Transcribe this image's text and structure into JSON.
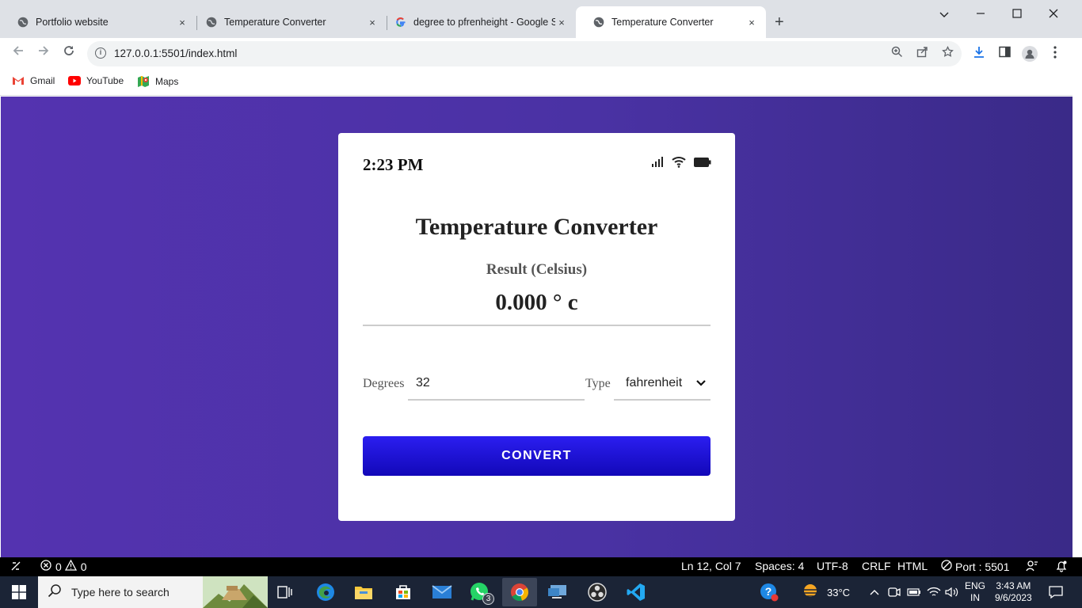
{
  "browser": {
    "tabs": [
      {
        "title": "Portfolio website",
        "close": "×"
      },
      {
        "title": "Temperature Converter",
        "close": "×"
      },
      {
        "title": "degree to pfrenheight - Google S",
        "close": "×"
      },
      {
        "title": "Temperature Converter",
        "close": "×"
      }
    ],
    "new_tab": "+",
    "url": "127.0.0.1:5501/index.html",
    "bookmarks": [
      "Gmail",
      "YouTube",
      "Maps"
    ]
  },
  "app": {
    "clock": "2:23 PM",
    "title": "Temperature Converter",
    "result_label": "Result (Celsius)",
    "result_value": "0.000 ° c",
    "degrees_label": "Degrees",
    "degrees_value": "32",
    "type_label": "Type",
    "type_value": "fahrenheit",
    "convert_label": "CONVERT"
  },
  "vscode_status": {
    "errors": "0",
    "warnings": "0",
    "position": "Ln 12, Col 7",
    "spaces": "Spaces: 4",
    "encoding": "UTF-8",
    "eol": "CRLF",
    "language": "HTML",
    "port": "Port : 5501"
  },
  "taskbar": {
    "search_placeholder": "Type here to search",
    "whatsapp_badge": "3",
    "weather": "33°C",
    "lang_top": "ENG",
    "lang_bottom": "IN",
    "time": "3:43 AM",
    "date": "9/6/2023"
  },
  "colors": {
    "page_gradient_start": "#5433b0",
    "page_gradient_end": "#3a2a88",
    "button_blue": "#2b1ef0"
  }
}
